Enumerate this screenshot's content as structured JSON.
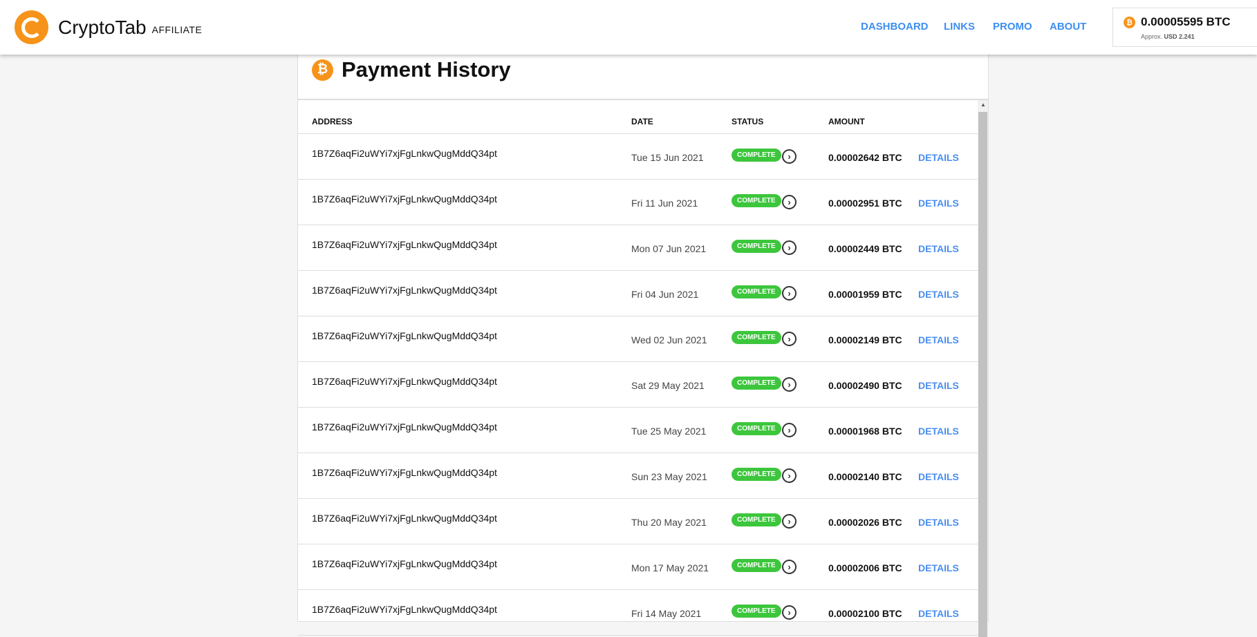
{
  "header": {
    "brand": "CryptoTab",
    "brand_suffix": "AFFILIATE",
    "nav": [
      "DASHBOARD",
      "LINKS",
      "PROMO",
      "ABOUT"
    ],
    "balance": {
      "value": "0.00005595 BTC",
      "approx_label": "Approx.",
      "approx_value": "USD 2.241"
    }
  },
  "page": {
    "title": "Payment History"
  },
  "table": {
    "columns": [
      "ADDRESS",
      "DATE",
      "STATUS",
      "AMOUNT"
    ],
    "rows": [
      {
        "address": "1B7Z6aqFi2uWYi7xjFgLnkwQugMddQ34pt",
        "date": "Tue 15 Jun 2021",
        "status": "COMPLETE",
        "amount": "0.00002642 BTC",
        "action": "DETAILS"
      },
      {
        "address": "1B7Z6aqFi2uWYi7xjFgLnkwQugMddQ34pt",
        "date": "Fri 11 Jun 2021",
        "status": "COMPLETE",
        "amount": "0.00002951 BTC",
        "action": "DETAILS"
      },
      {
        "address": "1B7Z6aqFi2uWYi7xjFgLnkwQugMddQ34pt",
        "date": "Mon 07 Jun 2021",
        "status": "COMPLETE",
        "amount": "0.00002449 BTC",
        "action": "DETAILS"
      },
      {
        "address": "1B7Z6aqFi2uWYi7xjFgLnkwQugMddQ34pt",
        "date": "Fri 04 Jun 2021",
        "status": "COMPLETE",
        "amount": "0.00001959 BTC",
        "action": "DETAILS"
      },
      {
        "address": "1B7Z6aqFi2uWYi7xjFgLnkwQugMddQ34pt",
        "date": "Wed 02 Jun 2021",
        "status": "COMPLETE",
        "amount": "0.00002149 BTC",
        "action": "DETAILS"
      },
      {
        "address": "1B7Z6aqFi2uWYi7xjFgLnkwQugMddQ34pt",
        "date": "Sat 29 May 2021",
        "status": "COMPLETE",
        "amount": "0.00002490 BTC",
        "action": "DETAILS"
      },
      {
        "address": "1B7Z6aqFi2uWYi7xjFgLnkwQugMddQ34pt",
        "date": "Tue 25 May 2021",
        "status": "COMPLETE",
        "amount": "0.00001968 BTC",
        "action": "DETAILS"
      },
      {
        "address": "1B7Z6aqFi2uWYi7xjFgLnkwQugMddQ34pt",
        "date": "Sun 23 May 2021",
        "status": "COMPLETE",
        "amount": "0.00002140 BTC",
        "action": "DETAILS"
      },
      {
        "address": "1B7Z6aqFi2uWYi7xjFgLnkwQugMddQ34pt",
        "date": "Thu 20 May 2021",
        "status": "COMPLETE",
        "amount": "0.00002026 BTC",
        "action": "DETAILS"
      },
      {
        "address": "1B7Z6aqFi2uWYi7xjFgLnkwQugMddQ34pt",
        "date": "Mon 17 May 2021",
        "status": "COMPLETE",
        "amount": "0.00002006 BTC",
        "action": "DETAILS"
      },
      {
        "address": "1B7Z6aqFi2uWYi7xjFgLnkwQugMddQ34pt",
        "date": "Fri 14 May 2021",
        "status": "COMPLETE",
        "amount": "0.00002100 BTC",
        "action": "DETAILS"
      }
    ]
  },
  "colors": {
    "accent": "#3d8ef0",
    "bitcoin": "#f7931a",
    "complete": "#3cc63c"
  }
}
